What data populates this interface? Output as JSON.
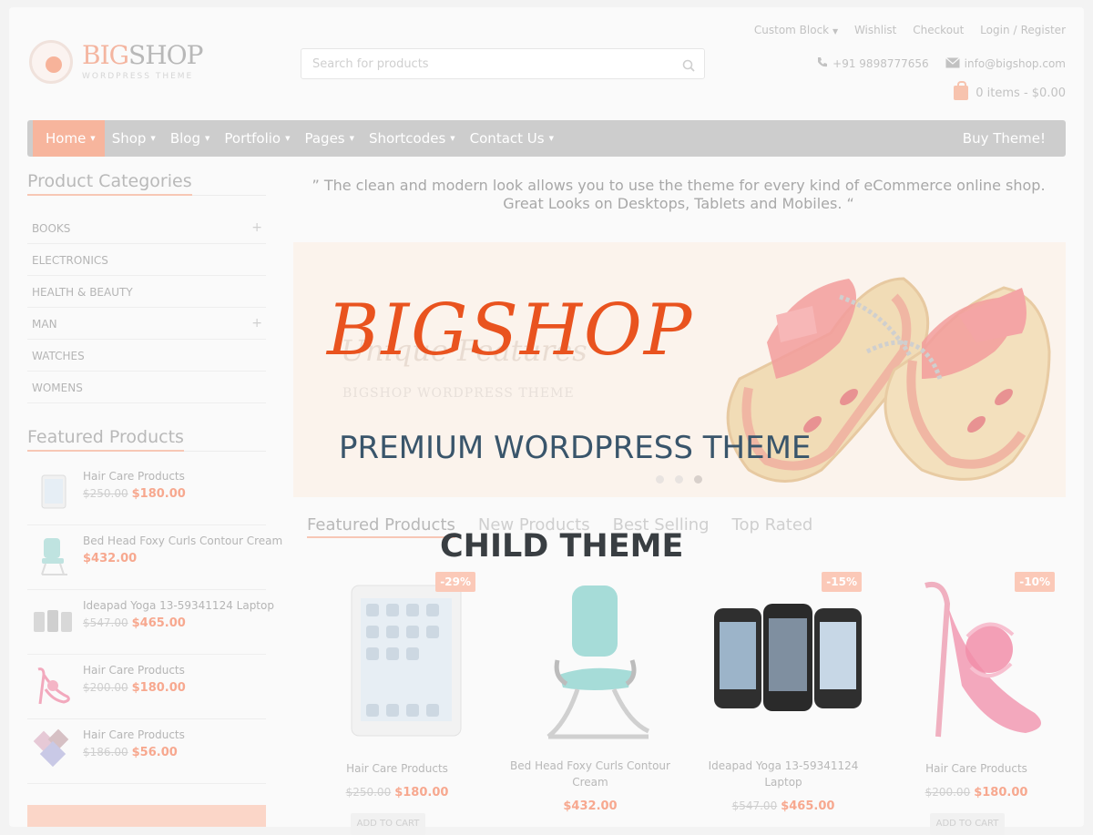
{
  "header": {
    "logo_big": "BIG",
    "logo_shop": "SHOP",
    "logo_sub": "WORDPRESS THEME",
    "search_placeholder": "Search for products",
    "top_links": [
      "Custom Block",
      "Wishlist",
      "Checkout",
      "Login",
      "/",
      "Register"
    ],
    "phone": "+91 9898777656",
    "email": "info@bigshop.com",
    "cart": "0 items - $0.00"
  },
  "nav": {
    "items": [
      "Home",
      "Shop",
      "Blog",
      "Portfolio",
      "Pages",
      "Shortcodes",
      "Contact Us"
    ],
    "buy": "Buy Theme!"
  },
  "sidebar": {
    "categories_title": "Product Categories",
    "categories": [
      "BOOKS",
      "ELECTRONICS",
      "HEALTH & BEAUTY",
      "MAN",
      "WATCHES",
      "WOMENS"
    ],
    "featured_title": "Featured Products",
    "featured": [
      {
        "name": "Hair Care Products",
        "old": "$250.00",
        "new": "$180.00"
      },
      {
        "name": "Bed Head Foxy Curls Contour Cream",
        "old": "",
        "new": "$432.00"
      },
      {
        "name": "Ideapad Yoga 13-59341124 Laptop",
        "old": "$547.00",
        "new": "$465.00"
      },
      {
        "name": "Hair Care Products",
        "old": "$200.00",
        "new": "$180.00"
      },
      {
        "name": "Hair Care Products",
        "old": "$186.00",
        "new": "$56.00"
      }
    ]
  },
  "main": {
    "quote": "” The clean and modern look allows you to use the theme for every kind of eCommerce online shop. Great Looks on Desktops, Tablets and Mobiles. “",
    "slider_bg_title": "Unique Features",
    "slider_bg_sub": "BIGSHOP WORDPRESS THEME",
    "overlay_title": "BIGSHOP",
    "overlay_sub": "PREMIUM WORDPRESS THEME",
    "child_theme": "CHILD THEME",
    "tabs": [
      "Featured Products",
      "New Products",
      "Best Selling",
      "Top Rated"
    ],
    "products": [
      {
        "name": "Hair Care Products",
        "old": "$250.00",
        "new": "$180.00",
        "badge": "-29%",
        "button": "ADD TO CART"
      },
      {
        "name": "Bed Head Foxy Curls Contour Cream",
        "old": "",
        "new": "$432.00",
        "badge": "",
        "button": ""
      },
      {
        "name": "Ideapad Yoga 13-59341124 Laptop",
        "old": "$547.00",
        "new": "$465.00",
        "badge": "-15%",
        "button": ""
      },
      {
        "name": "Hair Care Products",
        "old": "$200.00",
        "new": "$180.00",
        "badge": "-10%",
        "button": "ADD TO CART"
      }
    ]
  },
  "colors": {
    "accent": "#f7b59d",
    "title_orange": "#e9531f",
    "subtitle_blue": "#39556b"
  }
}
